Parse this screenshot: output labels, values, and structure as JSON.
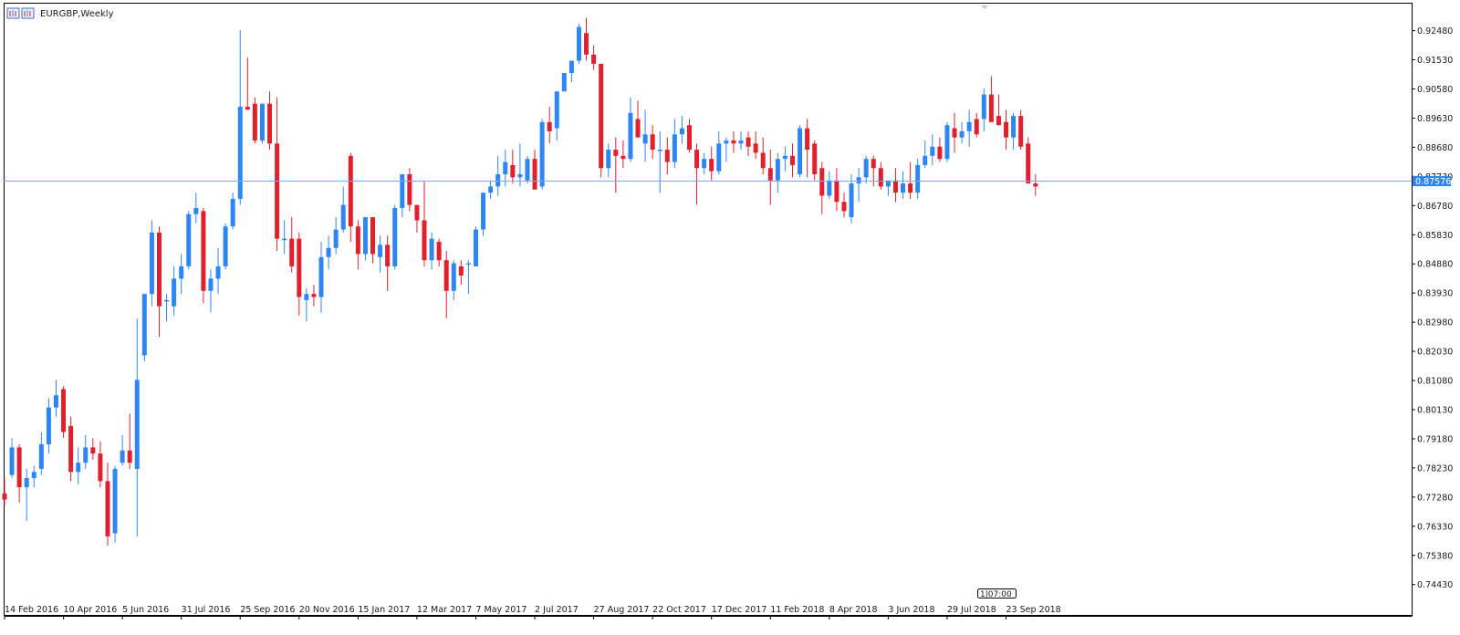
{
  "window": {
    "title": "EURGBP,Weekly",
    "current_price": "0.87576",
    "countdown": "1|07:00"
  },
  "colors": {
    "bull": "#2E86F5",
    "bear": "#E0202C",
    "price_line": "#7FA8F5",
    "axis": "#000000",
    "background": "#FFFFFF"
  },
  "chart_data": {
    "type": "candlestick",
    "symbol": "EURGBP",
    "timeframe": "Weekly",
    "y_range": [
      0.735,
      0.933
    ],
    "y_ticks": [
      "0.92480",
      "0.91530",
      "0.90580",
      "0.89630",
      "0.88680",
      "0.87730",
      "0.86780",
      "0.85830",
      "0.84880",
      "0.83930",
      "0.82980",
      "0.82030",
      "0.81080",
      "0.80130",
      "0.79180",
      "0.78230",
      "0.77280",
      "0.76330",
      "0.75380",
      "0.74430"
    ],
    "x_labels": [
      {
        "index": 0,
        "label": "14 Feb 2016"
      },
      {
        "index": 8,
        "label": "10 Apr 2016"
      },
      {
        "index": 16,
        "label": "5 Jun 2016"
      },
      {
        "index": 24,
        "label": "31 Jul 2016"
      },
      {
        "index": 32,
        "label": "25 Sep 2016"
      },
      {
        "index": 40,
        "label": "20 Nov 2016"
      },
      {
        "index": 48,
        "label": "15 Jan 2017"
      },
      {
        "index": 56,
        "label": "12 Mar 2017"
      },
      {
        "index": 64,
        "label": "7 May 2017"
      },
      {
        "index": 72,
        "label": "2 Jul 2017"
      },
      {
        "index": 80,
        "label": "27 Aug 2017"
      },
      {
        "index": 88,
        "label": "22 Oct 2017"
      },
      {
        "index": 96,
        "label": "17 Dec 2017"
      },
      {
        "index": 104,
        "label": "11 Feb 2018"
      },
      {
        "index": 112,
        "label": "8 Apr 2018"
      },
      {
        "index": 120,
        "label": "3 Jun 2018"
      },
      {
        "index": 128,
        "label": "29 Jul 2018"
      },
      {
        "index": 136,
        "label": "23 Sep 2018"
      }
    ],
    "current_price": 0.87576,
    "ohlc": [
      [
        0.774,
        0.779,
        0.77,
        0.772
      ],
      [
        0.78,
        0.792,
        0.779,
        0.789
      ],
      [
        0.789,
        0.79,
        0.771,
        0.776
      ],
      [
        0.776,
        0.782,
        0.765,
        0.779
      ],
      [
        0.779,
        0.783,
        0.776,
        0.781
      ],
      [
        0.782,
        0.794,
        0.78,
        0.79
      ],
      [
        0.79,
        0.805,
        0.787,
        0.802
      ],
      [
        0.802,
        0.811,
        0.799,
        0.806
      ],
      [
        0.808,
        0.809,
        0.792,
        0.794
      ],
      [
        0.796,
        0.799,
        0.778,
        0.781
      ],
      [
        0.781,
        0.789,
        0.777,
        0.784
      ],
      [
        0.784,
        0.793,
        0.782,
        0.789
      ],
      [
        0.789,
        0.792,
        0.785,
        0.787
      ],
      [
        0.787,
        0.791,
        0.776,
        0.778
      ],
      [
        0.778,
        0.784,
        0.757,
        0.76
      ],
      [
        0.761,
        0.783,
        0.758,
        0.782
      ],
      [
        0.784,
        0.793,
        0.783,
        0.788
      ],
      [
        0.788,
        0.8,
        0.782,
        0.784
      ],
      [
        0.782,
        0.831,
        0.76,
        0.811
      ],
      [
        0.819,
        0.838,
        0.817,
        0.839
      ],
      [
        0.839,
        0.863,
        0.835,
        0.859
      ],
      [
        0.859,
        0.861,
        0.825,
        0.835
      ],
      [
        0.837,
        0.839,
        0.83,
        0.837
      ],
      [
        0.835,
        0.848,
        0.832,
        0.844
      ],
      [
        0.844,
        0.852,
        0.839,
        0.848
      ],
      [
        0.848,
        0.866,
        0.847,
        0.865
      ],
      [
        0.865,
        0.872,
        0.862,
        0.867
      ],
      [
        0.866,
        0.867,
        0.836,
        0.84
      ],
      [
        0.84,
        0.847,
        0.833,
        0.844
      ],
      [
        0.844,
        0.854,
        0.839,
        0.848
      ],
      [
        0.848,
        0.862,
        0.847,
        0.861
      ],
      [
        0.861,
        0.872,
        0.86,
        0.87
      ],
      [
        0.87,
        0.925,
        0.868,
        0.9
      ],
      [
        0.9,
        0.916,
        0.899,
        0.899
      ],
      [
        0.901,
        0.903,
        0.888,
        0.889
      ],
      [
        0.889,
        0.901,
        0.888,
        0.901
      ],
      [
        0.901,
        0.905,
        0.886,
        0.888
      ],
      [
        0.888,
        0.903,
        0.853,
        0.857
      ],
      [
        0.857,
        0.863,
        0.852,
        0.857
      ],
      [
        0.857,
        0.864,
        0.846,
        0.848
      ],
      [
        0.857,
        0.859,
        0.832,
        0.838
      ],
      [
        0.837,
        0.841,
        0.83,
        0.839
      ],
      [
        0.839,
        0.842,
        0.835,
        0.838
      ],
      [
        0.838,
        0.856,
        0.833,
        0.851
      ],
      [
        0.851,
        0.858,
        0.847,
        0.854
      ],
      [
        0.854,
        0.864,
        0.852,
        0.86
      ],
      [
        0.86,
        0.874,
        0.859,
        0.868
      ],
      [
        0.884,
        0.885,
        0.856,
        0.861
      ],
      [
        0.861,
        0.863,
        0.847,
        0.852
      ],
      [
        0.852,
        0.864,
        0.85,
        0.864
      ],
      [
        0.864,
        0.864,
        0.849,
        0.852
      ],
      [
        0.851,
        0.858,
        0.846,
        0.855
      ],
      [
        0.855,
        0.858,
        0.84,
        0.848
      ],
      [
        0.848,
        0.868,
        0.847,
        0.867
      ],
      [
        0.867,
        0.878,
        0.864,
        0.878
      ],
      [
        0.878,
        0.88,
        0.866,
        0.868
      ],
      [
        0.868,
        0.868,
        0.859,
        0.863
      ],
      [
        0.863,
        0.876,
        0.848,
        0.85
      ],
      [
        0.85,
        0.859,
        0.847,
        0.857
      ],
      [
        0.856,
        0.857,
        0.848,
        0.85
      ],
      [
        0.85,
        0.853,
        0.831,
        0.84
      ],
      [
        0.84,
        0.85,
        0.837,
        0.849
      ],
      [
        0.848,
        0.85,
        0.842,
        0.845
      ],
      [
        0.849,
        0.85,
        0.839,
        0.849
      ],
      [
        0.848,
        0.861,
        0.848,
        0.86
      ],
      [
        0.86,
        0.868,
        0.858,
        0.872
      ],
      [
        0.872,
        0.876,
        0.87,
        0.874
      ],
      [
        0.874,
        0.884,
        0.871,
        0.878
      ],
      [
        0.878,
        0.886,
        0.874,
        0.882
      ],
      [
        0.881,
        0.886,
        0.875,
        0.877
      ],
      [
        0.877,
        0.888,
        0.874,
        0.878
      ],
      [
        0.876,
        0.884,
        0.875,
        0.883
      ],
      [
        0.883,
        0.886,
        0.874,
        0.873
      ],
      [
        0.874,
        0.896,
        0.873,
        0.895
      ],
      [
        0.895,
        0.9,
        0.888,
        0.892
      ],
      [
        0.893,
        0.904,
        0.889,
        0.905
      ],
      [
        0.905,
        0.911,
        0.905,
        0.911
      ],
      [
        0.911,
        0.915,
        0.908,
        0.915
      ],
      [
        0.915,
        0.927,
        0.914,
        0.926
      ],
      [
        0.924,
        0.929,
        0.915,
        0.917
      ],
      [
        0.917,
        0.92,
        0.912,
        0.914
      ],
      [
        0.914,
        0.914,
        0.877,
        0.88
      ],
      [
        0.88,
        0.888,
        0.877,
        0.886
      ],
      [
        0.886,
        0.89,
        0.872,
        0.884
      ],
      [
        0.884,
        0.889,
        0.88,
        0.883
      ],
      [
        0.883,
        0.903,
        0.882,
        0.898
      ],
      [
        0.896,
        0.902,
        0.892,
        0.89
      ],
      [
        0.888,
        0.899,
        0.882,
        0.891
      ],
      [
        0.891,
        0.894,
        0.883,
        0.886
      ],
      [
        0.886,
        0.892,
        0.872,
        0.886
      ],
      [
        0.886,
        0.89,
        0.878,
        0.882
      ],
      [
        0.882,
        0.896,
        0.88,
        0.891
      ],
      [
        0.891,
        0.897,
        0.888,
        0.893
      ],
      [
        0.894,
        0.896,
        0.885,
        0.886
      ],
      [
        0.886,
        0.888,
        0.868,
        0.88
      ],
      [
        0.88,
        0.885,
        0.878,
        0.883
      ],
      [
        0.883,
        0.887,
        0.876,
        0.879
      ],
      [
        0.879,
        0.892,
        0.878,
        0.888
      ],
      [
        0.888,
        0.89,
        0.882,
        0.889
      ],
      [
        0.889,
        0.892,
        0.885,
        0.888
      ],
      [
        0.888,
        0.892,
        0.886,
        0.889
      ],
      [
        0.89,
        0.892,
        0.884,
        0.887
      ],
      [
        0.888,
        0.892,
        0.883,
        0.885
      ],
      [
        0.885,
        0.89,
        0.878,
        0.88
      ],
      [
        0.88,
        0.886,
        0.868,
        0.876
      ],
      [
        0.876,
        0.885,
        0.872,
        0.883
      ],
      [
        0.883,
        0.887,
        0.879,
        0.884
      ],
      [
        0.884,
        0.888,
        0.877,
        0.881
      ],
      [
        0.878,
        0.894,
        0.877,
        0.893
      ],
      [
        0.893,
        0.896,
        0.877,
        0.886
      ],
      [
        0.888,
        0.889,
        0.876,
        0.878
      ],
      [
        0.88,
        0.882,
        0.865,
        0.871
      ],
      [
        0.871,
        0.879,
        0.87,
        0.876
      ],
      [
        0.876,
        0.88,
        0.866,
        0.869
      ],
      [
        0.869,
        0.872,
        0.864,
        0.866
      ],
      [
        0.864,
        0.878,
        0.862,
        0.875
      ],
      [
        0.875,
        0.88,
        0.869,
        0.877
      ],
      [
        0.877,
        0.884,
        0.875,
        0.883
      ],
      [
        0.883,
        0.884,
        0.874,
        0.88
      ],
      [
        0.88,
        0.882,
        0.873,
        0.874
      ],
      [
        0.874,
        0.876,
        0.871,
        0.876
      ],
      [
        0.876,
        0.88,
        0.869,
        0.872
      ],
      [
        0.872,
        0.879,
        0.87,
        0.875
      ],
      [
        0.875,
        0.882,
        0.87,
        0.872
      ],
      [
        0.872,
        0.883,
        0.87,
        0.881
      ],
      [
        0.881,
        0.889,
        0.88,
        0.884
      ],
      [
        0.884,
        0.891,
        0.881,
        0.887
      ],
      [
        0.887,
        0.89,
        0.882,
        0.883
      ],
      [
        0.883,
        0.895,
        0.882,
        0.894
      ],
      [
        0.893,
        0.898,
        0.885,
        0.89
      ],
      [
        0.89,
        0.895,
        0.888,
        0.892
      ],
      [
        0.892,
        0.899,
        0.887,
        0.895
      ],
      [
        0.896,
        0.898,
        0.89,
        0.891
      ],
      [
        0.896,
        0.906,
        0.892,
        0.904
      ],
      [
        0.904,
        0.91,
        0.896,
        0.895
      ],
      [
        0.897,
        0.904,
        0.894,
        0.894
      ],
      [
        0.895,
        0.899,
        0.886,
        0.89
      ],
      [
        0.89,
        0.898,
        0.886,
        0.897
      ],
      [
        0.897,
        0.899,
        0.886,
        0.887
      ],
      [
        0.888,
        0.89,
        0.875,
        0.875
      ],
      [
        0.875,
        0.878,
        0.871,
        0.874
      ]
    ]
  }
}
